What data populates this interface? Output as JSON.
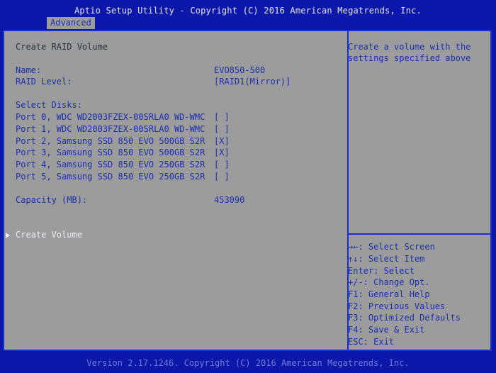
{
  "header": {
    "title": "Aptio Setup Utility - Copyright (C) 2016 American Megatrends, Inc.",
    "tab": "Advanced"
  },
  "main": {
    "section_title": "Create RAID Volume",
    "name_label": "Name:",
    "name_value": "EVO850-500",
    "raid_level_label": "RAID Level:",
    "raid_level_value": "[RAID1(Mirror)]",
    "select_disks_label": "Select Disks:",
    "disks": [
      {
        "label": "Port 0, WDC WD2003FZEX-00SRLA0 WD-WMC",
        "value": "[ ]"
      },
      {
        "label": "Port 1, WDC WD2003FZEX-00SRLA0 WD-WMC",
        "value": "[ ]"
      },
      {
        "label": "Port 2, Samsung SSD 850 EVO 500GB S2R",
        "value": "[X]"
      },
      {
        "label": "Port 3, Samsung SSD 850 EVO 500GB S2R",
        "value": "[X]"
      },
      {
        "label": "Port 4, Samsung SSD 850 EVO 250GB S2R",
        "value": "[ ]"
      },
      {
        "label": "Port 5, Samsung SSD 850 EVO 250GB S2R",
        "value": "[ ]"
      }
    ],
    "capacity_label": "Capacity (MB):",
    "capacity_value": "453090",
    "create_volume_label": "Create Volume"
  },
  "help": {
    "description": [
      "Create a volume with the",
      "settings specified above"
    ],
    "keys": [
      "→←: Select Screen",
      "↑↓: Select Item",
      "Enter: Select",
      "+/-: Change Opt.",
      "F1: General Help",
      "F2: Previous Values",
      "F3: Optimized Defaults",
      "F4: Save & Exit",
      "ESC: Exit"
    ]
  },
  "footer": {
    "text": "Version 2.17.1246. Copyright (C) 2016 American Megatrends, Inc."
  },
  "colors": {
    "background_blue": "#0b17a8",
    "panel_gray": "#9c9c9c",
    "text_blue": "#1a2fb0",
    "highlight_white": "#ececf4"
  }
}
